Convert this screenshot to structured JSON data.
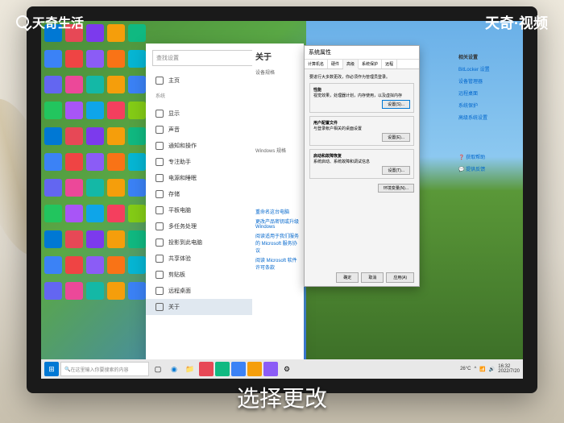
{
  "watermarks": {
    "top_left": "天奇生活",
    "top_right": "天奇·视频"
  },
  "subtitle": "选择更改",
  "settings_window": {
    "search_placeholder": "查找设置",
    "home": "主页",
    "category": "系统",
    "items": [
      {
        "label": "显示"
      },
      {
        "label": "声音"
      },
      {
        "label": "通知和操作"
      },
      {
        "label": "专注助手"
      },
      {
        "label": "电源和睡眠"
      },
      {
        "label": "存储"
      },
      {
        "label": "平板电脑"
      },
      {
        "label": "多任务处理"
      },
      {
        "label": "投影到此电脑"
      },
      {
        "label": "共享体验"
      },
      {
        "label": "剪贴板"
      },
      {
        "label": "远程桌面"
      },
      {
        "label": "关于"
      }
    ]
  },
  "about_panel": {
    "title": "关于",
    "device_heading": "设备规格",
    "windows_heading": "Windows 规格",
    "links": [
      "重命名这台电脑",
      "更改产品密钥或升级 Windows",
      "阅读适用于我们服务的 Microsoft 服务协议",
      "阅读 Microsoft 软件许可条款"
    ]
  },
  "sysprops": {
    "title": "系统属性",
    "tabs": [
      "计算机名",
      "硬件",
      "高级",
      "系统保护",
      "远程"
    ],
    "active_tab": "高级",
    "note": "要进行大多数更改，你必须作为管理员登录。",
    "groups": [
      {
        "title": "性能",
        "desc": "视觉效果，处理器计划，内存使用，以及虚拟内存",
        "btn": "设置(S)..."
      },
      {
        "title": "用户配置文件",
        "desc": "与登录帐户相关的桌面设置",
        "btn": "设置(E)..."
      },
      {
        "title": "启动和故障恢复",
        "desc": "系统启动、系统故障和调试信息",
        "btn": "设置(T)..."
      }
    ],
    "env_btn": "环境变量(N)...",
    "footer": [
      "确定",
      "取消",
      "应用(A)"
    ]
  },
  "right_links": {
    "heading": "相关设置",
    "items": [
      "BitLocker 设置",
      "设备管理器",
      "远程桌面",
      "系统保护",
      "高级系统设置"
    ],
    "help_heading": "获取帮助",
    "feedback": "提供反馈"
  },
  "taskbar": {
    "search_placeholder": "在这里输入你要搜索的内容",
    "weather": "26°C",
    "time": "16:32",
    "date": "2022/7/20"
  },
  "desktop_icon_colors": [
    "#0078d4",
    "#e74856",
    "#7c3aed",
    "#f59e0b",
    "#10b981",
    "#3b82f6",
    "#ef4444",
    "#8b5cf6",
    "#f97316",
    "#06b6d4",
    "#6366f1",
    "#ec4899",
    "#14b8a6",
    "#f59e0b",
    "#3b82f6",
    "#22c55e",
    "#a855f7",
    "#0ea5e9",
    "#f43f5e",
    "#84cc16",
    "#0078d4",
    "#e74856",
    "#7c3aed",
    "#f59e0b",
    "#10b981",
    "#3b82f6",
    "#ef4444",
    "#8b5cf6",
    "#f97316",
    "#06b6d4",
    "#6366f1",
    "#ec4899",
    "#14b8a6",
    "#f59e0b",
    "#3b82f6",
    "#22c55e",
    "#a855f7",
    "#0ea5e9",
    "#f43f5e",
    "#84cc16",
    "#0078d4",
    "#e74856",
    "#7c3aed",
    "#f59e0b",
    "#10b981",
    "#3b82f6",
    "#ef4444",
    "#8b5cf6",
    "#f97316",
    "#06b6d4",
    "#6366f1",
    "#ec4899",
    "#14b8a6",
    "#f59e0b",
    "#3b82f6"
  ]
}
